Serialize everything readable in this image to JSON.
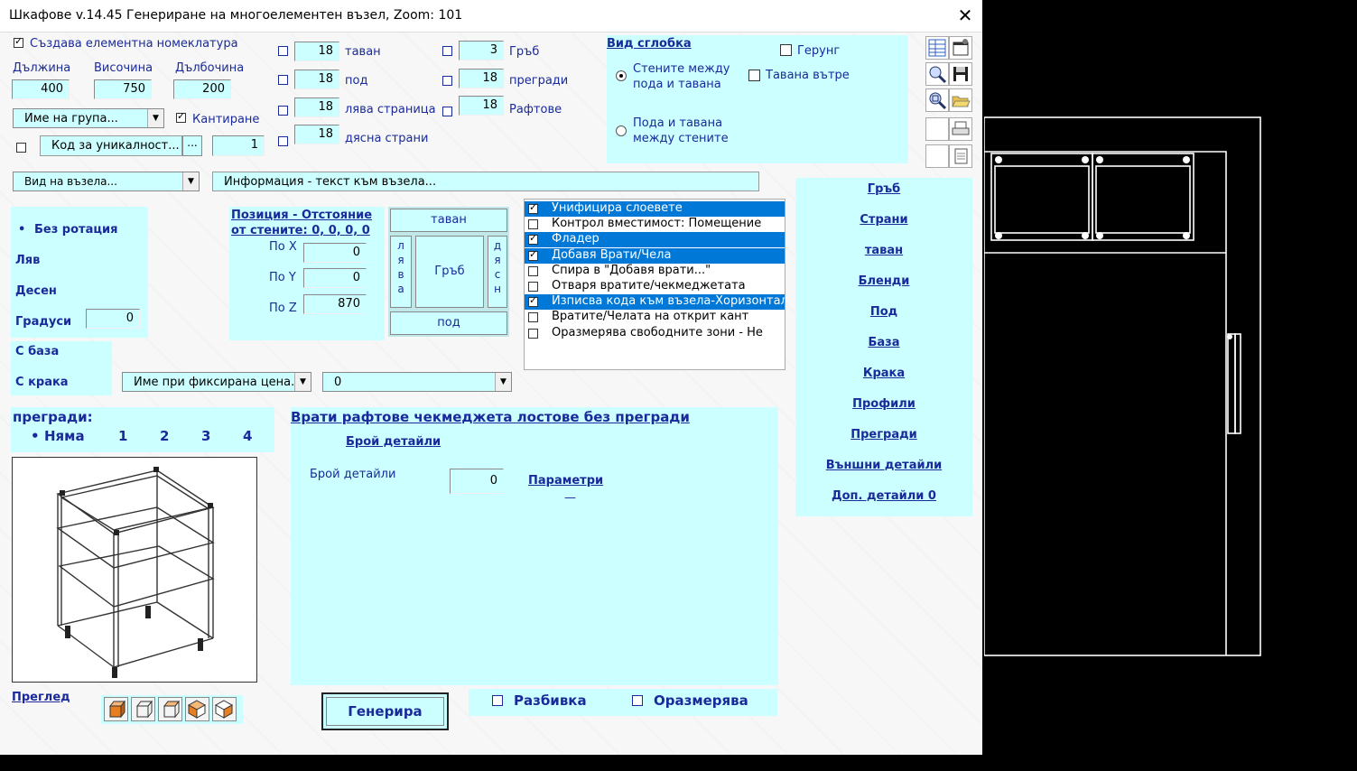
{
  "window": {
    "title": "Шкафове v.14.45 Генериране на многоелементен възел, Zoom:  101",
    "close": "✕"
  },
  "top_left": {
    "nomenclature_label": "Създава елементна номеклатура",
    "length_label": "Дължина",
    "height_label": "Височина",
    "depth_label": "Дълбочина",
    "length": "400",
    "height": "750",
    "depth": "200",
    "group_name": "Име на група...",
    "edging_label": "Кантиране",
    "uniqueness_code": "Код за уникалност...",
    "ellipsis": "...",
    "count": "1",
    "node_type": "Вид на възела...",
    "info_text": "Информация - текст към възела..."
  },
  "thickness": {
    "ceiling_val": "18",
    "ceiling_label": "таван",
    "floor_val": "18",
    "floor_label": "под",
    "left_val": "18",
    "left_label": "лява страница",
    "right_val": "18",
    "right_label": "дясна страница",
    "back_val": "3",
    "back_label": "Гръб",
    "partitions_val": "18",
    "partitions_label": "прегради",
    "shelves_val": "18",
    "shelves_label": "Рафтове"
  },
  "assembly": {
    "title": "Вид сглобка",
    "gerung": "Герунг",
    "opt1_line1": "Стените между",
    "opt1_line2": "пода и тавана",
    "opt2_line1": "Пода и тавана",
    "opt2_line2": "между стените",
    "ceiling_inside": "Тавана вътре"
  },
  "rotation": {
    "none": "Без ротация",
    "left": "Ляв",
    "right": "Десен",
    "degrees": "Градуси",
    "degrees_val": "0",
    "with_base": "С база",
    "with_legs": "С крака"
  },
  "position": {
    "title_line1": "Позиция - Отстояние",
    "title_line2": "от стените: 0, 0, 0, 0",
    "x_label": "По X",
    "y_label": "По Y",
    "z_label": "По Z",
    "x": "0",
    "y": "0",
    "z": "870"
  },
  "selector": {
    "top": "таван",
    "left": "л я в а",
    "center": "Гръб",
    "right": "д я с н",
    "bottom": "под"
  },
  "options_list": [
    {
      "label": "Унифицира слоевете",
      "checked": true,
      "selected": true
    },
    {
      "label": "Контрол вместимост: Помещение",
      "checked": false,
      "selected": false
    },
    {
      "label": "Фладер",
      "checked": true,
      "selected": true
    },
    {
      "label": "Добавя Врати/Чела",
      "checked": true,
      "selected": true
    },
    {
      "label": "Спира в \"Добавя врати...\"",
      "checked": false,
      "selected": false
    },
    {
      "label": "Отваря вратите/чекмеджетата",
      "checked": false,
      "selected": false
    },
    {
      "label": "Изписва кода към възела-Хоризонтално",
      "checked": true,
      "selected": true
    },
    {
      "label": "Вратите/Челата на открит кант",
      "checked": false,
      "selected": false
    },
    {
      "label": "Оразмерява свободните зони - Не",
      "checked": false,
      "selected": false
    }
  ],
  "fixed_price": {
    "name": "Име при фиксирана цена...",
    "value": "0"
  },
  "partitions": {
    "title": "прегради:",
    "none": "Няма",
    "opts": [
      "1",
      "2",
      "3",
      "4"
    ]
  },
  "doors": {
    "title": "Врати рафтове чекмеджета лостове без прегради",
    "count_link": "Брой детайли",
    "count_label": "Брой детайли",
    "count_val": "0",
    "params": "Параметри",
    "dash": "—"
  },
  "nav": [
    "Гръб",
    "Страни",
    "таван",
    "Бленди",
    "Под",
    "База",
    "Крака",
    "Профили",
    "Прегради",
    "Външни детайли",
    "Доп. детайли 0"
  ],
  "bottom": {
    "preview": "Преглед",
    "generate": "Генерира",
    "explode": "Разбивка",
    "dimension": "Оразмерява"
  }
}
